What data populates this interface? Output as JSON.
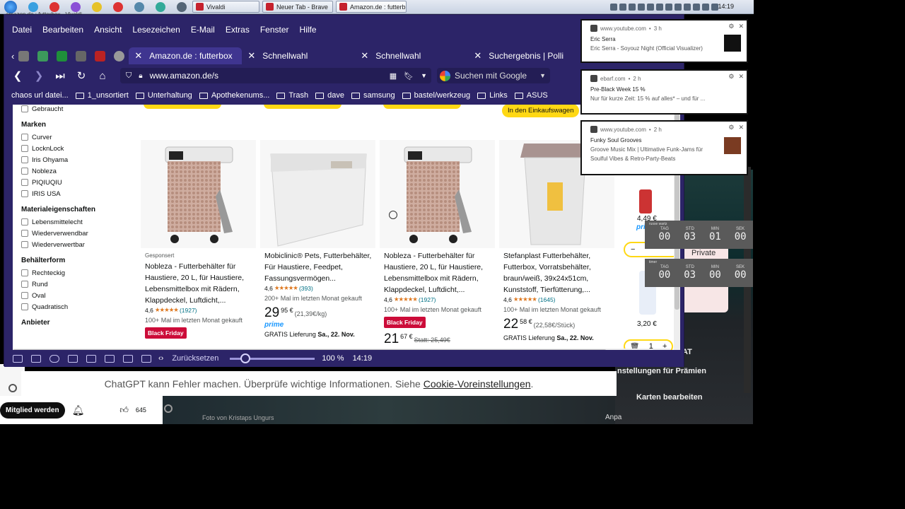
{
  "taskbar": {
    "start_icon": "windows-orb",
    "pinned_icons": [
      "app-1",
      "app-2",
      "app-3",
      "app-4",
      "app-5",
      "app-6",
      "app-7",
      "app-8"
    ],
    "tabs": [
      {
        "label": "amazon.de : futterbox - Vivaldi"
      },
      {
        "label": "Vivaldi"
      },
      {
        "label": "Neuer Tab - Brave"
      },
      {
        "label": "Amazon.de : futterb..."
      }
    ],
    "clock": "14:19"
  },
  "menu": [
    "Datei",
    "Bearbeiten",
    "Ansicht",
    "Lesezeichen",
    "E-Mail",
    "Extras",
    "Fenster",
    "Hilfe"
  ],
  "tabs": [
    {
      "label": "Amazon.de : futterbox",
      "active": true
    },
    {
      "label": "Schnellwahl"
    },
    {
      "label": "Schnellwahl"
    },
    {
      "label": "Suchergebnis | Polli"
    }
  ],
  "address": {
    "url": "www.amazon.de/s",
    "search_placeholder": "Suchen mit Google"
  },
  "bookmarks": [
    "chaos url datei...",
    "1_unsortiert",
    "Unterhaltung",
    "Apothekenums...",
    "Trash",
    "dave",
    "samsung",
    "bastel/werkzeug",
    "Links",
    "ASUS"
  ],
  "filters": {
    "top_item": "Gebraucht",
    "marken_title": "Marken",
    "marken": [
      "Curver",
      "LocknLock",
      "Iris Ohyama",
      "Nobleza",
      "PIQIUQIU",
      "IRIS USA"
    ],
    "material_title": "Materialeigenschaften",
    "material": [
      "Lebensmittelecht",
      "Wiederverwendbar",
      "Wiederverwertbar"
    ],
    "form_title": "Behälterform",
    "form": [
      "Rechteckig",
      "Rund",
      "Oval",
      "Quadratisch"
    ],
    "anbieter_title": "Anbieter"
  },
  "top_button": "In den Einkaufswagen",
  "products": [
    {
      "sponsored": "Gesponsert",
      "title": "Nobleza - Futterbehälter für Haustiere, 20 L, für Haustiere, Lebensmittelbox mit Rädern, Klappdeckel, Luftdicht,...",
      "rating": "4,6",
      "reviews": "(1927)",
      "bought": "100+ Mal im letzten Monat gekauft",
      "badge": "Black Friday"
    },
    {
      "title": "Mobiclinic® Pets, Futterbehälter, Für Haustiere, Feedpet, Fassungsvermögen...",
      "rating": "4,6",
      "reviews": "(393)",
      "bought": "200+ Mal im letzten Monat gekauft",
      "price_whole": "29",
      "price_frac": "95 €",
      "unit": "(21,39€/kg)",
      "prime": "prime",
      "delivery": "GRATIS Lieferung",
      "delivery_date": "Sa., 22. Nov."
    },
    {
      "title": "Nobleza - Futterbehälter für Haustiere, 20 L, für Haustiere, Lebensmittelbox mit Rädern, Klappdeckel, Luftdicht,...",
      "rating": "4,6",
      "reviews": "(1927)",
      "bought": "100+ Mal im letzten Monat gekauft",
      "badge": "Black Friday",
      "price_whole": "21",
      "price_frac": "67 €",
      "old_price": "Statt: 25,49€"
    },
    {
      "title": "Stefanplast Futterbehälter, Futterbox, Vorratsbehälter, braun/weiß, 39x24x51cm, Kunststoff, Tierfütterung,...",
      "rating": "4,6",
      "reviews": "(1645)",
      "bought": "100+ Mal im letzten Monat gekauft",
      "price_whole": "22",
      "price_frac": "58 €",
      "unit": "(22,58€/Stück)",
      "delivery": "GRATIS Lieferung",
      "delivery_date": "Sa., 22. Nov."
    }
  ],
  "side_product": {
    "price": "4,49 €",
    "prime": "prime",
    "price2": "3,20 €",
    "qty": "1"
  },
  "statusbar": {
    "reset": "Zurücksetzen",
    "zoom": "100 %",
    "time": "14:19"
  },
  "chatgpt": {
    "text": "ChatGPT kann Fehler machen. Überprüfe wichtige Informationen. Siehe",
    "link": "Cookie-Voreinstellungen",
    "end": "."
  },
  "youtube": {
    "member": "Mitglied werden",
    "likes": "645"
  },
  "right_bg": {
    "private": "Private",
    "at": "AT",
    "praemien": "nstellungen für Prämien",
    "karten": "Karten bearbeiten",
    "ank": "nk",
    "anpa": "Anpa"
  },
  "bg_caption": "Foto von Kristaps Ungurs",
  "notifications": [
    {
      "site": "www.youtube.com",
      "age": "3 h",
      "title": "Eric Serra",
      "message": "Eric Serra - Soyouz Night (Official Visualizer)"
    },
    {
      "site": "ebarf.com",
      "age": "2 h",
      "title": "Pre-Black Week 15 %",
      "message": "Nur für kurze Zeit: 15 % auf alles* – und für ..."
    },
    {
      "site": "www.youtube.com",
      "age": "2 h",
      "title": "Funky Soul Grooves",
      "message": "Groove Music Mix | Ultimative Funk-Jams für Soulful Vibes & Retro-Party-Beats"
    }
  ],
  "timers": [
    {
      "title": "russe wartz",
      "labels": [
        "TAG",
        "STD",
        "MIN",
        "SEK"
      ],
      "values": [
        "00",
        "03",
        "01",
        "00"
      ]
    },
    {
      "title": "timer",
      "labels": [
        "TAG",
        "STD",
        "MIN",
        "SEK"
      ],
      "values": [
        "00",
        "03",
        "00",
        "00"
      ]
    }
  ],
  "colors": {
    "browser_bg": "#2c2468",
    "prime": "#1a98ff",
    "black_friday": "#cc0c39",
    "star": "#de7921",
    "cart": "#ffd814"
  }
}
